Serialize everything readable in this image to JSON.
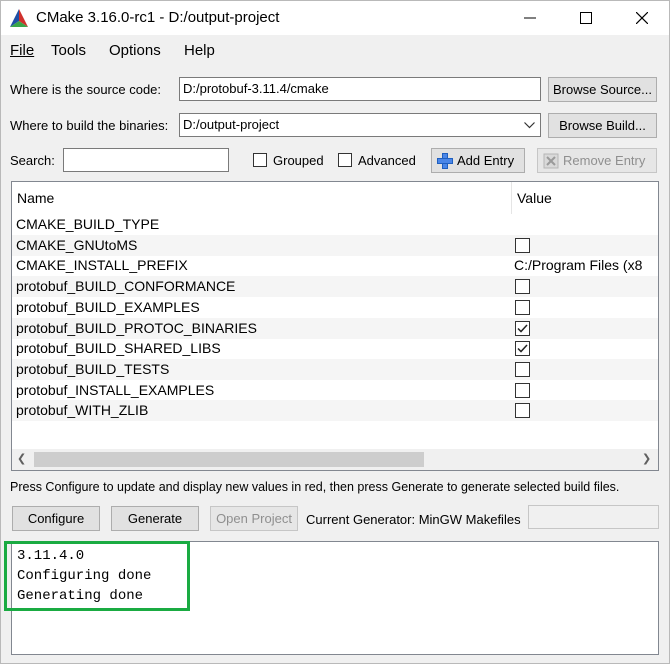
{
  "window": {
    "title": "CMake 3.16.0-rc1 - D:/output-project"
  },
  "menu": {
    "file": "File",
    "tools": "Tools",
    "options": "Options",
    "help": "Help"
  },
  "source": {
    "label": "Where is the source code:",
    "value": "D:/protobuf-3.11.4/cmake",
    "browse": "Browse Source..."
  },
  "build": {
    "label": "Where to build the binaries:",
    "value": "D:/output-project",
    "browse": "Browse Build..."
  },
  "search": {
    "label": "Search:",
    "value": "",
    "grouped": "Grouped",
    "advanced": "Advanced",
    "add_entry": "Add Entry",
    "remove_entry": "Remove Entry"
  },
  "table": {
    "columns": {
      "name": "Name",
      "value": "Value"
    },
    "rows": [
      {
        "name": "CMAKE_BUILD_TYPE",
        "type": "text",
        "value": ""
      },
      {
        "name": "CMAKE_GNUtoMS",
        "type": "bool",
        "checked": false
      },
      {
        "name": "CMAKE_INSTALL_PREFIX",
        "type": "text",
        "value": "C:/Program Files (x8"
      },
      {
        "name": "protobuf_BUILD_CONFORMANCE",
        "type": "bool",
        "checked": false
      },
      {
        "name": "protobuf_BUILD_EXAMPLES",
        "type": "bool",
        "checked": false
      },
      {
        "name": "protobuf_BUILD_PROTOC_BINARIES",
        "type": "bool",
        "checked": true
      },
      {
        "name": "protobuf_BUILD_SHARED_LIBS",
        "type": "bool",
        "checked": true
      },
      {
        "name": "protobuf_BUILD_TESTS",
        "type": "bool",
        "checked": false
      },
      {
        "name": "protobuf_INSTALL_EXAMPLES",
        "type": "bool",
        "checked": false
      },
      {
        "name": "protobuf_WITH_ZLIB",
        "type": "bool",
        "checked": false
      }
    ]
  },
  "hint": "Press Configure to update and display new values in red, then press Generate to generate selected build files.",
  "actions": {
    "configure": "Configure",
    "generate": "Generate",
    "open_project": "Open Project",
    "generator_label": "Current Generator: MinGW Makefiles"
  },
  "console": {
    "lines": [
      "3.11.4.0",
      "Configuring done",
      "Generating done"
    ]
  },
  "colors": {
    "highlight": "#1aab42",
    "add_icon": "#1f5fbf"
  }
}
